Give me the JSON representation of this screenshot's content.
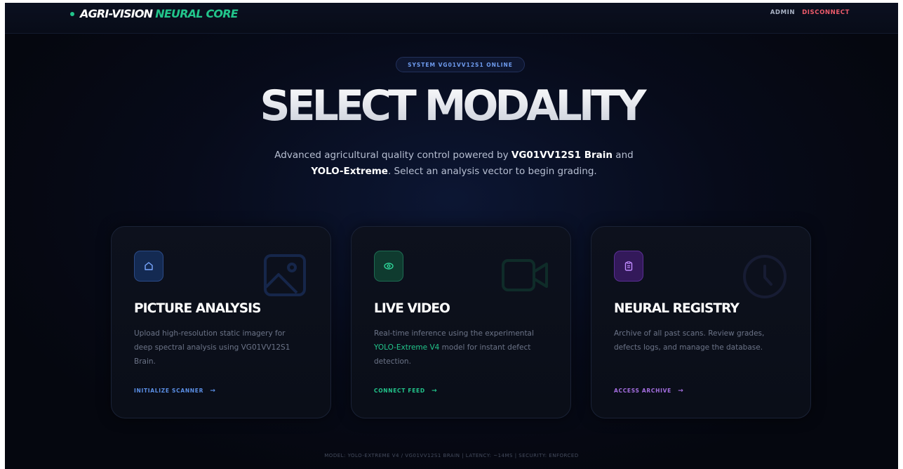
{
  "nav": {
    "brand_main": "AGRI-VISION",
    "brand_sub": "NEURAL CORE",
    "admin_label": "ADMIN",
    "disconnect_label": "DISCONNECT"
  },
  "hero": {
    "status_pill": "SYSTEM VG01VV12S1 ONLINE",
    "title": "SELECT MODALITY",
    "desc_pre": "Advanced agricultural quality control powered by ",
    "desc_bold1": "VG01VV12S1 Brain",
    "desc_mid": " and ",
    "desc_bold2": "YOLO-Extreme",
    "desc_post": ". Select an analysis vector to begin grading."
  },
  "cards": [
    {
      "icon": "home-icon",
      "bg_icon": "image-icon",
      "title": "PICTURE ANALYSIS",
      "desc": "Upload high-resolution static imagery for deep spectral analysis using VG01VV12S1 Brain.",
      "action": "INITIALIZE SCANNER",
      "arrow": "→",
      "accent": "#5b8fe6"
    },
    {
      "icon": "eye-icon",
      "bg_icon": "video-camera-icon",
      "title": "LIVE VIDEO",
      "desc_pre": "Real-time inference using the experimental ",
      "desc_accent": "YOLO-Extreme V4",
      "desc_post": " model for instant defect detection.",
      "action": "CONNECT FEED",
      "arrow": "→",
      "accent": "#22c58b"
    },
    {
      "icon": "clipboard-icon",
      "bg_icon": "clock-icon",
      "title": "NEURAL REGISTRY",
      "desc": "Archive of all past scans. Review grades, defects logs, and manage the database.",
      "action": "ACCESS ARCHIVE",
      "arrow": "→",
      "accent": "#a46ee0"
    }
  ],
  "footer": "MODEL: YOLO-EXTREME V4 / VG01VV12S1 BRAIN | LATENCY: ~14MS | SECURITY: ENFORCED"
}
